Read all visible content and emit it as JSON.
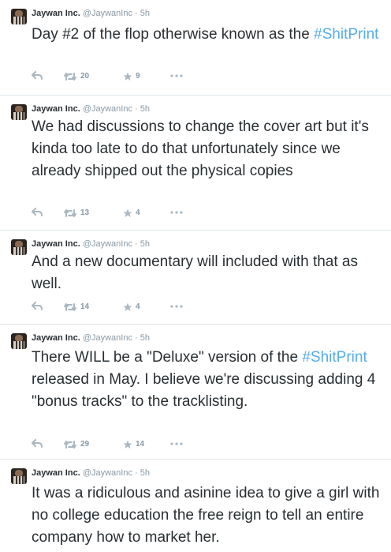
{
  "tweets": [
    {
      "name": "Jaywan Inc.",
      "handle": "@JaywanInc",
      "dot": "·",
      "time": "5h",
      "parts": [
        "Day #2 of the flop otherwise known as the ",
        "#ShitPrint",
        ""
      ],
      "retweets": "20",
      "favorites": "9"
    },
    {
      "name": "Jaywan Inc.",
      "handle": "@JaywanInc",
      "dot": "·",
      "time": "5h",
      "parts": [
        "We had discussions to change the cover art but it's kinda too late to do that unfortunately since we already shipped out the physical copies"
      ],
      "retweets": "13",
      "favorites": "4"
    },
    {
      "name": "Jaywan Inc.",
      "handle": "@JaywanInc",
      "dot": "·",
      "time": "5h",
      "parts": [
        "And a new documentary will included with that as well."
      ],
      "retweets": "14",
      "favorites": "4"
    },
    {
      "name": "Jaywan Inc.",
      "handle": "@JaywanInc",
      "dot": "·",
      "time": "5h",
      "parts": [
        "There WILL be a \"Deluxe\" version of the ",
        "#ShitPrint",
        " released in May.  I believe we're discussing adding 4 \"bonus tracks\" to the tracklisting."
      ],
      "retweets": "29",
      "favorites": "14"
    },
    {
      "name": "Jaywan Inc.",
      "handle": "@JaywanInc",
      "dot": "·",
      "time": "5h",
      "parts": [
        "It was a ridiculous and asinine idea to give a girl with no college education the free reign to tell an entire company how to market her."
      ]
    }
  ],
  "icons": {
    "reply": "reply-arrow-icon",
    "retweet": "retweet-icon",
    "favorite": "star-icon",
    "more": "more-dots-icon"
  },
  "colors": {
    "hashtag": "#55acee",
    "text": "#292f33",
    "muted": "#8899a6",
    "divider": "#e1e8ed"
  }
}
